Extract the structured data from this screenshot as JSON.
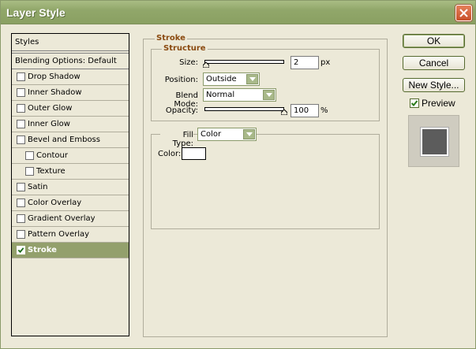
{
  "window": {
    "title": "Layer Style"
  },
  "styles_panel": {
    "header": "Styles",
    "blending": "Blending Options: Default",
    "items": [
      {
        "label": "Drop Shadow",
        "checked": false,
        "indent": false
      },
      {
        "label": "Inner Shadow",
        "checked": false,
        "indent": false
      },
      {
        "label": "Outer Glow",
        "checked": false,
        "indent": false
      },
      {
        "label": "Inner Glow",
        "checked": false,
        "indent": false
      },
      {
        "label": "Bevel and Emboss",
        "checked": false,
        "indent": false
      },
      {
        "label": "Contour",
        "checked": false,
        "indent": true
      },
      {
        "label": "Texture",
        "checked": false,
        "indent": true
      },
      {
        "label": "Satin",
        "checked": false,
        "indent": false
      },
      {
        "label": "Color Overlay",
        "checked": false,
        "indent": false
      },
      {
        "label": "Gradient Overlay",
        "checked": false,
        "indent": false
      },
      {
        "label": "Pattern Overlay",
        "checked": false,
        "indent": false
      },
      {
        "label": "Stroke",
        "checked": true,
        "indent": false,
        "active": true
      }
    ]
  },
  "stroke": {
    "title": "Stroke",
    "structure": {
      "title": "Structure",
      "size_label": "Size:",
      "size_value": "2",
      "size_unit": "px",
      "position_label": "Position:",
      "position_value": "Outside",
      "blend_label": "Blend Mode:",
      "blend_value": "Normal",
      "opacity_label": "Opacity:",
      "opacity_value": "100",
      "opacity_unit": "%"
    },
    "fill": {
      "type_label": "Fill Type:",
      "type_value": "Color",
      "color_label": "Color:",
      "color_value": "#ffffff"
    }
  },
  "buttons": {
    "ok": "OK",
    "cancel": "Cancel",
    "new_style": "New Style...",
    "preview_label": "Preview",
    "preview_checked": true
  },
  "colors": {
    "titlebar": "#91a76a",
    "active_row": "#93a06c",
    "legend_text": "#8a4a10",
    "preview_swatch": "#5c5c5c"
  }
}
